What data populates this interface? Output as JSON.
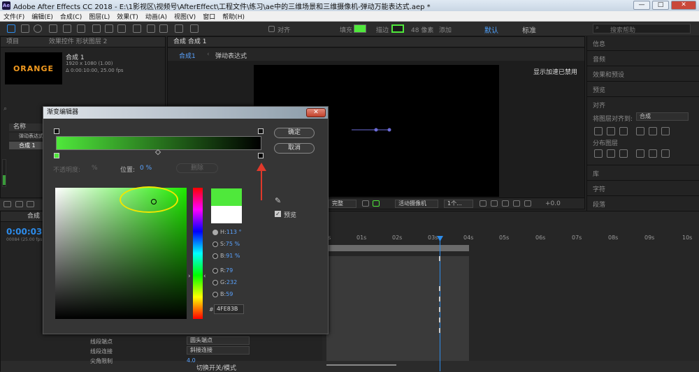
{
  "app": {
    "title": "Adobe After Effects CC 2018 - E:\\1影视区\\视频号\\AfterEffect\\工程文件\\练习\\ae中的三维场景和三维摄像机-弹动万能表达式.aep *",
    "icon_text": "Ae"
  },
  "window": {
    "minimize": "—",
    "maximize": "□",
    "close": "✕"
  },
  "menu": [
    "文件(F)",
    "编辑(E)",
    "合成(C)",
    "图层(L)",
    "效果(T)",
    "动画(A)",
    "视图(V)",
    "窗口",
    "帮助(H)"
  ],
  "toolbar": {
    "snap_label": "对齐",
    "fill_label": "填充",
    "stroke_label": "描边",
    "stroke_width": "48 像素",
    "add_label": "添加",
    "workspace_default": "默认",
    "workspace_standard": "标准",
    "search_placeholder": "搜索帮助"
  },
  "project": {
    "tab_project": "项目",
    "tab_effects": "效果控件 形状图层 2",
    "comp_name": "合成 1",
    "comp_size": "1920 x 1080 (1.00)",
    "comp_duration": "Δ 0:00:10:00, 25.00 fps",
    "thumb_text": "ORANGE",
    "col_name": "名称",
    "items": [
      "弹动表达式",
      "合成 1"
    ],
    "item_numbers": [
      "",
      "1"
    ]
  },
  "composition": {
    "tab": "合成 合成 1",
    "breadcrumb_1": "合成1",
    "breadcrumb_2": "弹动表达式",
    "gpu_notice": "显示加速已禁用",
    "controls_quality": "完整",
    "controls_camera": "活动摄像机",
    "controls_views": "1个...",
    "controls_offset": "+0.0"
  },
  "right_panel": [
    "信息",
    "音频",
    "效果和预设",
    "预览",
    "对齐",
    "将图层对齐到:",
    "合成",
    "分布图层",
    "库",
    "字符",
    "段落"
  ],
  "timeline": {
    "tab": "合成 1",
    "timecode": "0:00:03:0",
    "fps_hint": "00084 (25.00 fps)",
    "ticks": [
      "0s",
      "01s",
      "02s",
      "03s",
      "04s",
      "05s",
      "06s",
      "07s",
      "08s",
      "09s",
      "10s"
    ],
    "bottom_label": "切换开关/模式",
    "row1_label": "线段端点",
    "row1_value": "圆头端点",
    "row2_label": "线段连接",
    "row2_value": "斜接连接",
    "row3_label": "尖角限制",
    "row3_value": "4.0"
  },
  "gradient_editor": {
    "title": "渐变编辑器",
    "ok": "确定",
    "cancel": "取消",
    "opacity_label": "不透明度:",
    "opacity_value": "%",
    "position_label": "位置:",
    "position_value": "0 %",
    "delete_label": "删除",
    "preview_label": "预览",
    "h_label": "H:",
    "h_value": "113 °",
    "s_label": "S:",
    "s_value": "75 %",
    "b_label": "B:",
    "b_value": "91 %",
    "r_label": "R:",
    "r_value": "79",
    "g_label": "G:",
    "g_value": "232",
    "b2_label": "B:",
    "b2_value": "59",
    "hex_symbol": "#",
    "hex_value": "4FE83B",
    "color_new": "#4fe83b",
    "color_old": "#ffffff"
  },
  "colors": {
    "accent": "#2d8ceb",
    "highlight": "#f2e600",
    "arrow": "#e0392b"
  }
}
